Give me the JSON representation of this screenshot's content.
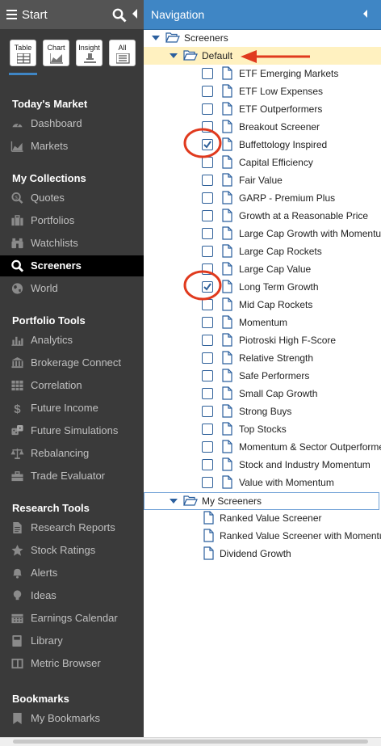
{
  "sidebar": {
    "header": {
      "title": "Start"
    },
    "modes": [
      {
        "label": "Table",
        "icon": "table-icon"
      },
      {
        "label": "Chart",
        "icon": "chart-icon"
      },
      {
        "label": "Insight",
        "icon": "insight-icon"
      },
      {
        "label": "All",
        "icon": "list-icon"
      }
    ],
    "sections": [
      {
        "title": "Today's Market",
        "items": [
          {
            "label": "Dashboard",
            "icon": "dashboard-icon"
          },
          {
            "label": "Markets",
            "icon": "area-chart-icon"
          }
        ]
      },
      {
        "title": "My Collections",
        "items": [
          {
            "label": "Quotes",
            "icon": "search-dollar-icon"
          },
          {
            "label": "Portfolios",
            "icon": "briefcase-icon"
          },
          {
            "label": "Watchlists",
            "icon": "binoculars-icon"
          },
          {
            "label": "Screeners",
            "icon": "search-icon",
            "active": true
          },
          {
            "label": "World",
            "icon": "globe-icon"
          }
        ]
      },
      {
        "title": "Portfolio Tools",
        "items": [
          {
            "label": "Analytics",
            "icon": "bar-chart-icon"
          },
          {
            "label": "Brokerage Connect",
            "icon": "bank-icon"
          },
          {
            "label": "Correlation",
            "icon": "grid-icon"
          },
          {
            "label": "Future Income",
            "icon": "dollar-icon"
          },
          {
            "label": "Future Simulations",
            "icon": "dice-icon"
          },
          {
            "label": "Rebalancing",
            "icon": "scales-icon"
          },
          {
            "label": "Trade Evaluator",
            "icon": "toolbox-icon"
          }
        ]
      },
      {
        "title": "Research Tools",
        "items": [
          {
            "label": "Research Reports",
            "icon": "document-icon"
          },
          {
            "label": "Stock Ratings",
            "icon": "star-icon"
          },
          {
            "label": "Alerts",
            "icon": "bell-icon"
          },
          {
            "label": "Ideas",
            "icon": "lightbulb-icon"
          },
          {
            "label": "Earnings Calendar",
            "icon": "calendar-icon"
          },
          {
            "label": "Library",
            "icon": "book-icon"
          },
          {
            "label": "Metric Browser",
            "icon": "columns-icon"
          }
        ]
      },
      {
        "title": "Bookmarks",
        "items": [
          {
            "label": "My Bookmarks",
            "icon": "bookmark-icon"
          }
        ]
      }
    ]
  },
  "navigation": {
    "title": "Navigation",
    "root_label": "Screeners",
    "default_folder": "Default",
    "default_items": [
      {
        "label": "ETF Emerging Markets",
        "checked": false
      },
      {
        "label": "ETF Low Expenses",
        "checked": false
      },
      {
        "label": "ETF Outperformers",
        "checked": false
      },
      {
        "label": "Breakout Screener",
        "checked": false
      },
      {
        "label": "Buffettology Inspired",
        "checked": true
      },
      {
        "label": "Capital Efficiency",
        "checked": false
      },
      {
        "label": "Fair Value",
        "checked": false
      },
      {
        "label": "GARP - Premium Plus",
        "checked": false
      },
      {
        "label": "Growth at a Reasonable Price",
        "checked": false
      },
      {
        "label": "Large Cap Growth with Momentum",
        "checked": false
      },
      {
        "label": "Large Cap Rockets",
        "checked": false
      },
      {
        "label": "Large Cap Value",
        "checked": false
      },
      {
        "label": "Long Term Growth",
        "checked": true
      },
      {
        "label": "Mid Cap Rockets",
        "checked": false
      },
      {
        "label": "Momentum",
        "checked": false
      },
      {
        "label": "Piotroski High F-Score",
        "checked": false
      },
      {
        "label": "Relative Strength",
        "checked": false
      },
      {
        "label": "Safe Performers",
        "checked": false
      },
      {
        "label": "Small Cap Growth",
        "checked": false
      },
      {
        "label": "Strong Buys",
        "checked": false
      },
      {
        "label": "Top Stocks",
        "checked": false
      },
      {
        "label": "Momentum & Sector Outperformers",
        "checked": false
      },
      {
        "label": "Stock and Industry Momentum",
        "checked": false
      },
      {
        "label": "Value with Momentum",
        "checked": false
      }
    ],
    "my_folder": "My Screeners",
    "my_items": [
      {
        "label": "Ranked Value Screener"
      },
      {
        "label": "Ranked Value Screener with Momentum"
      },
      {
        "label": "Dividend Growth"
      }
    ]
  },
  "colors": {
    "sidebar_bg": "#3a3a3a",
    "nav_header": "#3f86c5",
    "highlight_row": "#fff1c0",
    "annotation_red": "#e03a1e"
  }
}
